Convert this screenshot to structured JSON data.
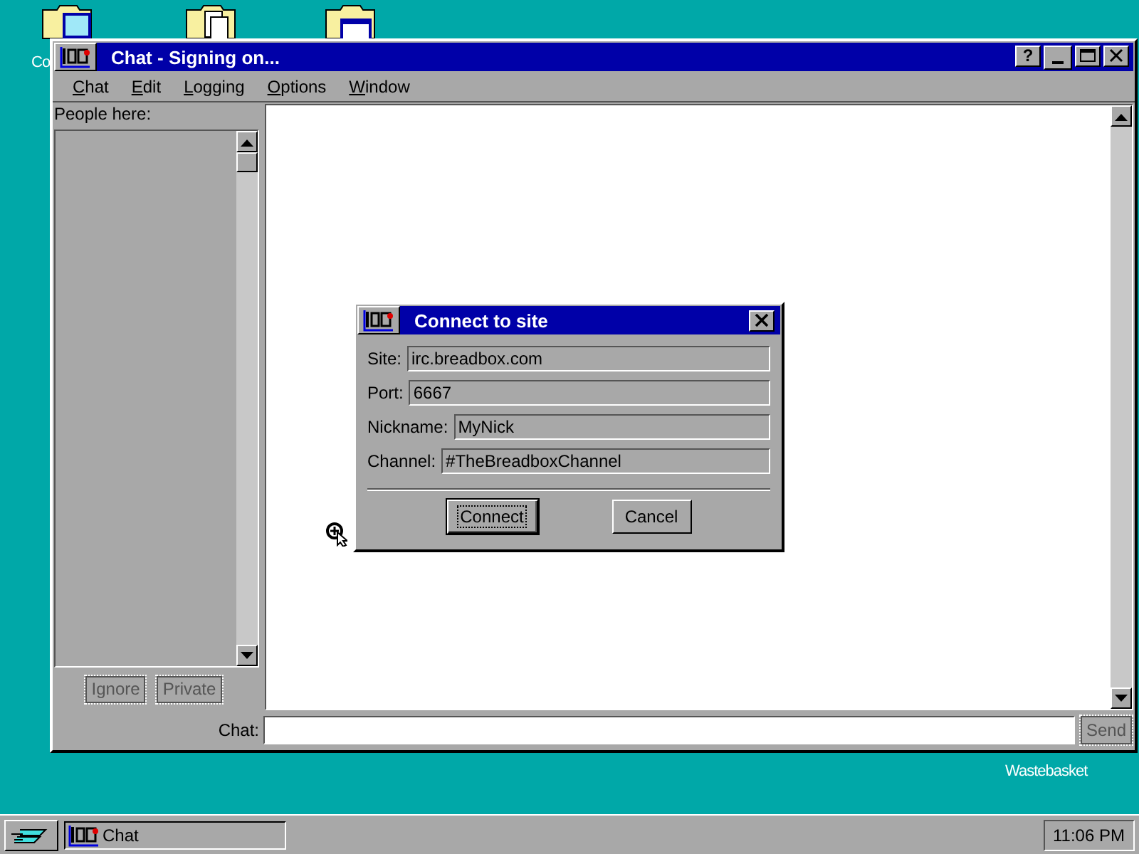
{
  "desktop_icons": [
    {
      "label": "Co"
    },
    {
      "label": "Wastebasket"
    }
  ],
  "window": {
    "title": "Chat - Signing on...",
    "title_buttons": [
      {
        "kind": "help",
        "label": "?"
      },
      {
        "kind": "minimize"
      },
      {
        "kind": "maximize"
      },
      {
        "kind": "close"
      }
    ],
    "menu": [
      "Chat",
      "Edit",
      "Logging",
      "Options",
      "Window"
    ],
    "people_label": "People here:",
    "people_buttons": [
      {
        "label": "Ignore",
        "disabled": true
      },
      {
        "label": "Private",
        "disabled": true
      }
    ],
    "chat_label": "Chat:",
    "send_button": {
      "label": "Send",
      "disabled": true
    }
  },
  "dialog": {
    "title": "Connect to site",
    "fields": [
      {
        "label": "Site:",
        "value": "irc.breadbox.com"
      },
      {
        "label": "Port:",
        "value": "6667"
      },
      {
        "label": "Nickname:",
        "value": "MyNick"
      },
      {
        "label": "Channel:",
        "value": "#TheBreadboxChannel"
      }
    ],
    "buttons": [
      {
        "label": "Connect",
        "default": true
      },
      {
        "label": "Cancel",
        "default": false
      }
    ]
  },
  "taskbar": {
    "tasks": [
      {
        "label": "Chat"
      }
    ],
    "clock": "11:06 PM"
  }
}
